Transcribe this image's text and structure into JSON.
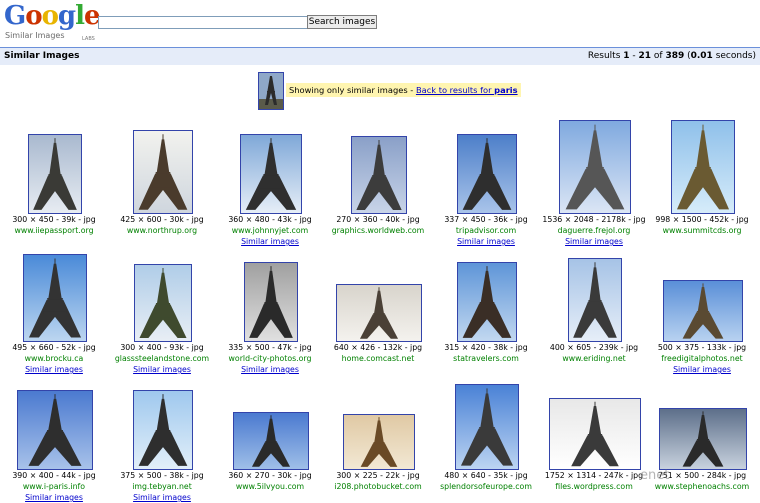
{
  "logo": {
    "letters": [
      "G",
      "o",
      "o",
      "g",
      "l",
      "e"
    ],
    "colors": [
      "#3366cc",
      "#cc3300",
      "#ffcc00",
      "#3366cc",
      "#33aa33",
      "#cc3300"
    ],
    "subtitle": "Similar Images",
    "labs": "LABS"
  },
  "search": {
    "value": "",
    "button_label": "Search images"
  },
  "results_bar": {
    "title": "Similar Images",
    "prefix": "Results ",
    "start": "1",
    "sep": " - ",
    "end": "21",
    "of": " of ",
    "total": "389",
    "time_open": " (",
    "time": "0.01",
    "time_close": " seconds)"
  },
  "notice": {
    "text": "Showing only similar images - ",
    "link": "Back to results for ",
    "query": "paris"
  },
  "similar_label": "Similar images",
  "results": [
    {
      "dims": "300 × 450 - 39k - jpg",
      "site": "www.iiepassport.org",
      "similar": false
    },
    {
      "dims": "425 × 600 - 30k - jpg",
      "site": "www.northrup.org",
      "similar": false
    },
    {
      "dims": "360 × 480 - 43k - jpg",
      "site": "www.johnnyjet.com",
      "similar": true
    },
    {
      "dims": "270 × 360 - 40k - jpg",
      "site": "graphics.worldweb.com",
      "similar": false
    },
    {
      "dims": "337 × 450 - 36k - jpg",
      "site": "tripadvisor.com",
      "similar": true
    },
    {
      "dims": "1536 × 2048 - 2178k - jpg",
      "site": "daguerre.frejol.org",
      "similar": true
    },
    {
      "dims": "998 × 1500 - 452k - jpg",
      "site": "www.summitcds.org",
      "similar": false
    },
    {
      "dims": "495 × 660 - 52k - jpg",
      "site": "www.brocku.ca",
      "similar": true
    },
    {
      "dims": "300 × 400 - 93k - jpg",
      "site": "glasssteelandstone.com",
      "similar": true
    },
    {
      "dims": "335 × 500 - 47k - jpg",
      "site": "world-city-photos.org",
      "similar": true
    },
    {
      "dims": "640 × 426 - 132k - jpg",
      "site": "home.comcast.net",
      "similar": false
    },
    {
      "dims": "315 × 420 - 38k - jpg",
      "site": "statravelers.com",
      "similar": false
    },
    {
      "dims": "400 × 605 - 239k - jpg",
      "site": "www.eriding.net",
      "similar": false
    },
    {
      "dims": "500 × 375 - 133k - jpg",
      "site": "freedigitalphotos.net",
      "similar": true
    },
    {
      "dims": "390 × 400 - 44k - jpg",
      "site": "www.i-paris.info",
      "similar": true
    },
    {
      "dims": "375 × 500 - 38k - jpg",
      "site": "img.tebyan.net",
      "similar": true
    },
    {
      "dims": "360 × 270 - 30k - jpg",
      "site": "www.5ilvyou.com",
      "similar": false
    },
    {
      "dims": "300 × 225 - 22k - jpg",
      "site": "i208.photobucket.com",
      "similar": false
    },
    {
      "dims": "480 × 640 - 35k - jpg",
      "site": "splendorsofeurope.com",
      "similar": false
    },
    {
      "dims": "1752 × 1314 - 247k - jpg",
      "site": "files.wordpress.com",
      "similar": false
    },
    {
      "dims": "751 × 500 - 284k - jpg",
      "site": "www.stephenoachs.com",
      "similar": false
    }
  ]
}
